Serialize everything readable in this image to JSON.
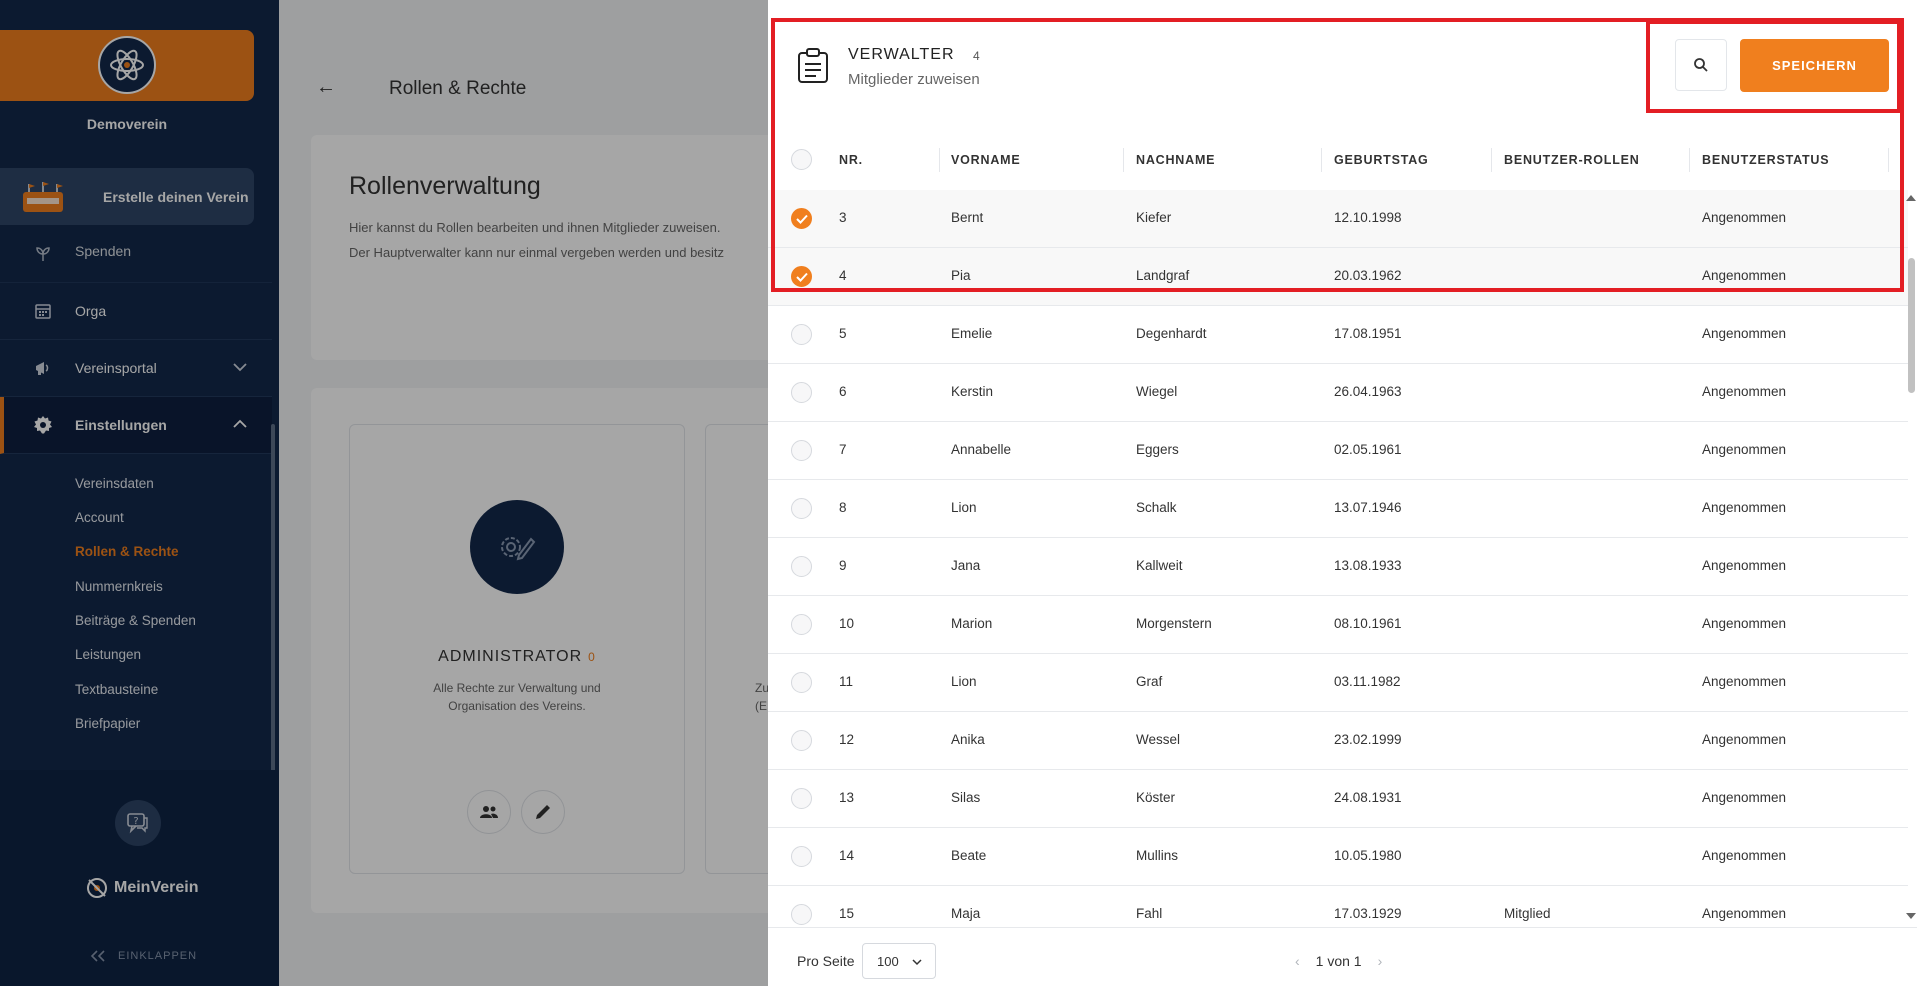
{
  "sidebar": {
    "club_name": "Demoverein",
    "create_club": "Erstelle deinen Verein",
    "nav": [
      {
        "label": "Spenden",
        "icon": "seedling-icon"
      },
      {
        "label": "Orga",
        "icon": "calendar-icon"
      },
      {
        "label": "Vereinsportal",
        "icon": "megaphone-icon"
      },
      {
        "label": "Einstellungen",
        "icon": "gear-icon"
      }
    ],
    "sub_items": [
      "Vereinsdaten",
      "Account",
      "Rollen & Rechte",
      "Nummernkreis",
      "Beiträge & Spenden",
      "Leistungen",
      "Textbausteine",
      "Briefpapier"
    ],
    "active_sub": "Rollen & Rechte",
    "brand": "MeinVerein",
    "collapse": "EINKLAPPEN"
  },
  "main": {
    "back_title": "Rollen & Rechte",
    "intro_title": "Rollenverwaltung",
    "intro_lines": [
      "Hier kannst du Rollen bearbeiten und ihnen Mitglieder zuweisen.",
      "Der Hauptverwalter kann nur einmal vergeben werden und besitz"
    ],
    "role": {
      "title": "ADMINISTRATOR",
      "count": "0",
      "desc_lines": [
        "Alle Rechte zur Verwaltung und",
        "Organisation des Vereins."
      ]
    },
    "role2_fragments": [
      "Zu",
      "(E"
    ]
  },
  "panel": {
    "title": "VERWALTER",
    "count": "4",
    "subtitle": "Mitglieder zuweisen",
    "save_label": "SPEICHERN",
    "columns": [
      "NR.",
      "VORNAME",
      "NACHNAME",
      "GEBURTSTAG",
      "BENUTZER-ROLLEN",
      "BENUTZERSTATUS"
    ],
    "rows": [
      {
        "nr": "3",
        "vorname": "Bernt",
        "nachname": "Kiefer",
        "geburtstag": "12.10.1998",
        "rollen": "",
        "status": "Angenommen",
        "checked": true
      },
      {
        "nr": "4",
        "vorname": "Pia",
        "nachname": "Landgraf",
        "geburtstag": "20.03.1962",
        "rollen": "",
        "status": "Angenommen",
        "checked": true
      },
      {
        "nr": "5",
        "vorname": "Emelie",
        "nachname": "Degenhardt",
        "geburtstag": "17.08.1951",
        "rollen": "",
        "status": "Angenommen",
        "checked": false
      },
      {
        "nr": "6",
        "vorname": "Kerstin",
        "nachname": "Wiegel",
        "geburtstag": "26.04.1963",
        "rollen": "",
        "status": "Angenommen",
        "checked": false
      },
      {
        "nr": "7",
        "vorname": "Annabelle",
        "nachname": "Eggers",
        "geburtstag": "02.05.1961",
        "rollen": "",
        "status": "Angenommen",
        "checked": false
      },
      {
        "nr": "8",
        "vorname": "Lion",
        "nachname": "Schalk",
        "geburtstag": "13.07.1946",
        "rollen": "",
        "status": "Angenommen",
        "checked": false
      },
      {
        "nr": "9",
        "vorname": "Jana",
        "nachname": "Kallweit",
        "geburtstag": "13.08.1933",
        "rollen": "",
        "status": "Angenommen",
        "checked": false
      },
      {
        "nr": "10",
        "vorname": "Marion",
        "nachname": "Morgenstern",
        "geburtstag": "08.10.1961",
        "rollen": "",
        "status": "Angenommen",
        "checked": false
      },
      {
        "nr": "11",
        "vorname": "Lion",
        "nachname": "Graf",
        "geburtstag": "03.11.1982",
        "rollen": "",
        "status": "Angenommen",
        "checked": false
      },
      {
        "nr": "12",
        "vorname": "Anika",
        "nachname": "Wessel",
        "geburtstag": "23.02.1999",
        "rollen": "",
        "status": "Angenommen",
        "checked": false
      },
      {
        "nr": "13",
        "vorname": "Silas",
        "nachname": "Köster",
        "geburtstag": "24.08.1931",
        "rollen": "",
        "status": "Angenommen",
        "checked": false
      },
      {
        "nr": "14",
        "vorname": "Beate",
        "nachname": "Mullins",
        "geburtstag": "10.05.1980",
        "rollen": "",
        "status": "Angenommen",
        "checked": false
      },
      {
        "nr": "15",
        "vorname": "Maja",
        "nachname": "Fahl",
        "geburtstag": "17.03.1929",
        "rollen": "Mitglied",
        "status": "Angenommen",
        "checked": false
      }
    ],
    "per_page_label": "Pro Seite",
    "per_page_value": "100",
    "pagination": "1 von 1"
  },
  "colors": {
    "accent": "#f07f1e",
    "sidebar": "#13294b",
    "highlight": "#e31e24"
  }
}
